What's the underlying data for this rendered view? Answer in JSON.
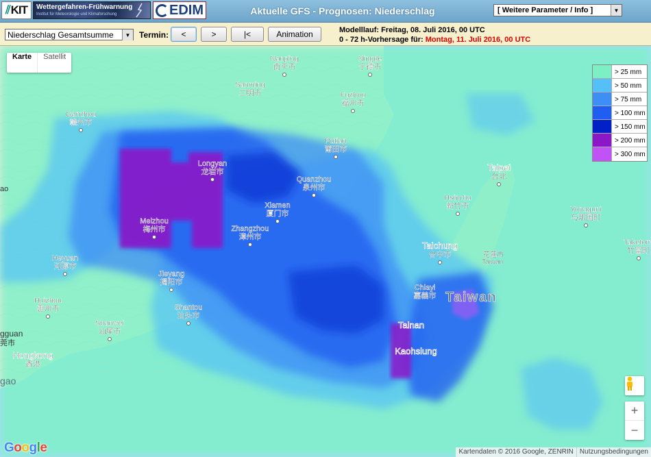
{
  "header": {
    "kit_logo": "KIT",
    "banner_title": "Wettergefahren-Frühwarnung",
    "banner_subtitle": "Institut für Meteorologie und Klimaforschung",
    "cedim_logo": "EDIM",
    "title": "Aktuelle GFS - Prognosen: Niederschlag",
    "param_select": "[ Weitere Parameter / Info ]"
  },
  "controls": {
    "variable_select": "Niederschlag Gesamtsumme",
    "termin_label": "Termin:",
    "btn_prev": "<",
    "btn_next": ">",
    "btn_first": "|<",
    "btn_animation": "Animation",
    "modelrun_label": "Modelllauf:",
    "modelrun_value": "Freitag, 08. Juli 2016, 00 UTC",
    "forecast_label": "0 - 72 h-Vorhersage für:",
    "forecast_value": "Montag, 11. Juli 2016, 00 UTC"
  },
  "map": {
    "maptype_map": "Karte",
    "maptype_satellite": "Satellit",
    "google_logo": [
      "G",
      "o",
      "o",
      "g",
      "l",
      "e"
    ],
    "attribution": "Kartendaten © 2016 Google, ZENRIN",
    "terms": "Nutzungsbedingungen",
    "zoom_in": "+",
    "zoom_out": "−",
    "country_label": "Taiwan",
    "places": [
      {
        "en": "Nanping",
        "zh": "南平市"
      },
      {
        "en": "Ningde",
        "zh": "宁德市"
      },
      {
        "en": "Sanming",
        "zh": "三明市"
      },
      {
        "en": "Fuzhou",
        "zh": "福州市"
      },
      {
        "en": "Ganzhou",
        "zh": "赣州市"
      },
      {
        "en": "Putian",
        "zh": "莆田市"
      },
      {
        "en": "Longyan",
        "zh": "龙岩市"
      },
      {
        "en": "Quanzhou",
        "zh": "泉州市"
      },
      {
        "en": "Xiamen",
        "zh": "厦门市"
      },
      {
        "en": "Meizhou",
        "zh": "梅州市"
      },
      {
        "en": "Zhangzhou",
        "zh": "漳州市"
      },
      {
        "en": "Heyuan",
        "zh": "河源市"
      },
      {
        "en": "Jieyang",
        "zh": "揭阳市"
      },
      {
        "en": "Huizhou",
        "zh": "惠州市"
      },
      {
        "en": "Shantou",
        "zh": "汕头市"
      },
      {
        "en": "Shanwei",
        "zh": "汕尾市"
      },
      {
        "en": "Hongkong",
        "zh": "香港"
      },
      {
        "en": "Taipei",
        "zh": "台北"
      },
      {
        "en": "Hsinchu",
        "zh": "新竹市"
      },
      {
        "en": "Taichung",
        "zh": "台中市"
      },
      {
        "en": "Chiayi",
        "zh": "嘉義市"
      },
      {
        "en": "Tainan",
        "zh": ""
      },
      {
        "en": "Kaohsiung",
        "zh": ""
      },
      {
        "en": "Yonaguni",
        "zh": "与那国町"
      },
      {
        "en": "Taketomi",
        "zh": "竹富町"
      }
    ],
    "edge_labels": [
      "gguan",
      "莞市",
      "gao",
      "ao",
      "ao"
    ],
    "partial_labels": [
      "Taiwan",
      "花蓮市"
    ]
  },
  "legend": [
    {
      "label": "> 25 mm",
      "color": "#7cf0c4"
    },
    {
      "label": "> 50 mm",
      "color": "#55c0f7"
    },
    {
      "label": "> 75 mm",
      "color": "#3d8ef5"
    },
    {
      "label": "> 100 mm",
      "color": "#1f5ef0"
    },
    {
      "label": "> 150 mm",
      "color": "#0021c8"
    },
    {
      "label": "> 200 mm",
      "color": "#8b17c8"
    },
    {
      "label": "> 300 mm",
      "color": "#c152f5"
    }
  ]
}
